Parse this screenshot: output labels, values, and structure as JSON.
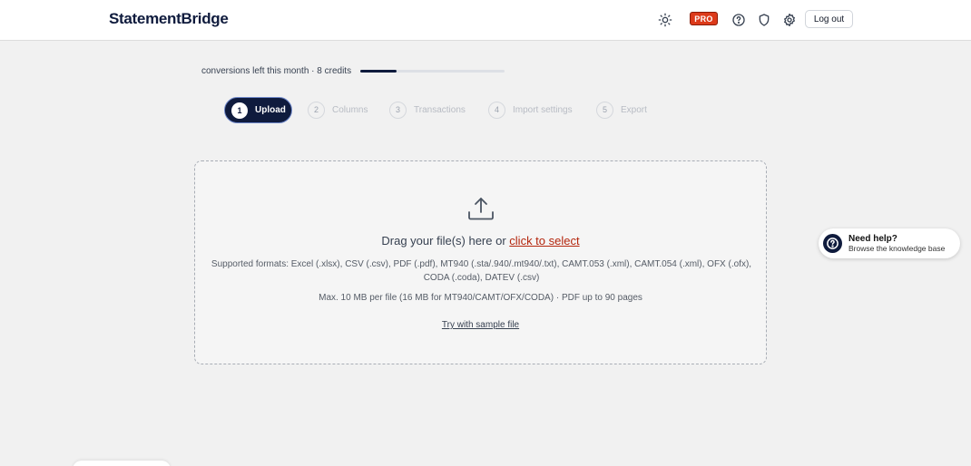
{
  "header": {
    "logo": "StatementBridge",
    "pro_badge": "PRO",
    "logout_label": "Log out",
    "icons": [
      "sun-icon",
      "help-circle-icon",
      "shield-icon",
      "gear-icon"
    ]
  },
  "credits": {
    "text": "conversions left this month · 8 credits",
    "progress_fraction": 0.25
  },
  "steps": [
    {
      "num": "1",
      "label": "Upload",
      "active": true
    },
    {
      "num": "2",
      "label": "Columns",
      "active": false
    },
    {
      "num": "3",
      "label": "Transactions",
      "active": false
    },
    {
      "num": "4",
      "label": "Import settings",
      "active": false
    },
    {
      "num": "5",
      "label": "Export",
      "active": false
    }
  ],
  "dropzone": {
    "drag_text": "Drag your file(s) here or",
    "click_select": "click to select",
    "formats_line1": "Supported formats: Excel (.xlsx), CSV (.csv), PDF (.pdf), MT940 (.sta/.940/.mt940/.txt), CAMT.053 (.xml), CAMT.054 (.xml), OFX (.ofx),",
    "formats_line2": "CODA (.coda), DATEV (.csv)",
    "max_size": "Max. 10 MB per file (16 MB for MT940/CAMT/OFX/CODA) · PDF up to 90 pages",
    "sample_link": "Try with sample file"
  },
  "help": {
    "title": "Need help?",
    "subtitle": "Browse the knowledge base"
  },
  "colors": {
    "brand": "#0f1b3d",
    "accent": "#b4260d",
    "pro": "#dc3a1a"
  }
}
